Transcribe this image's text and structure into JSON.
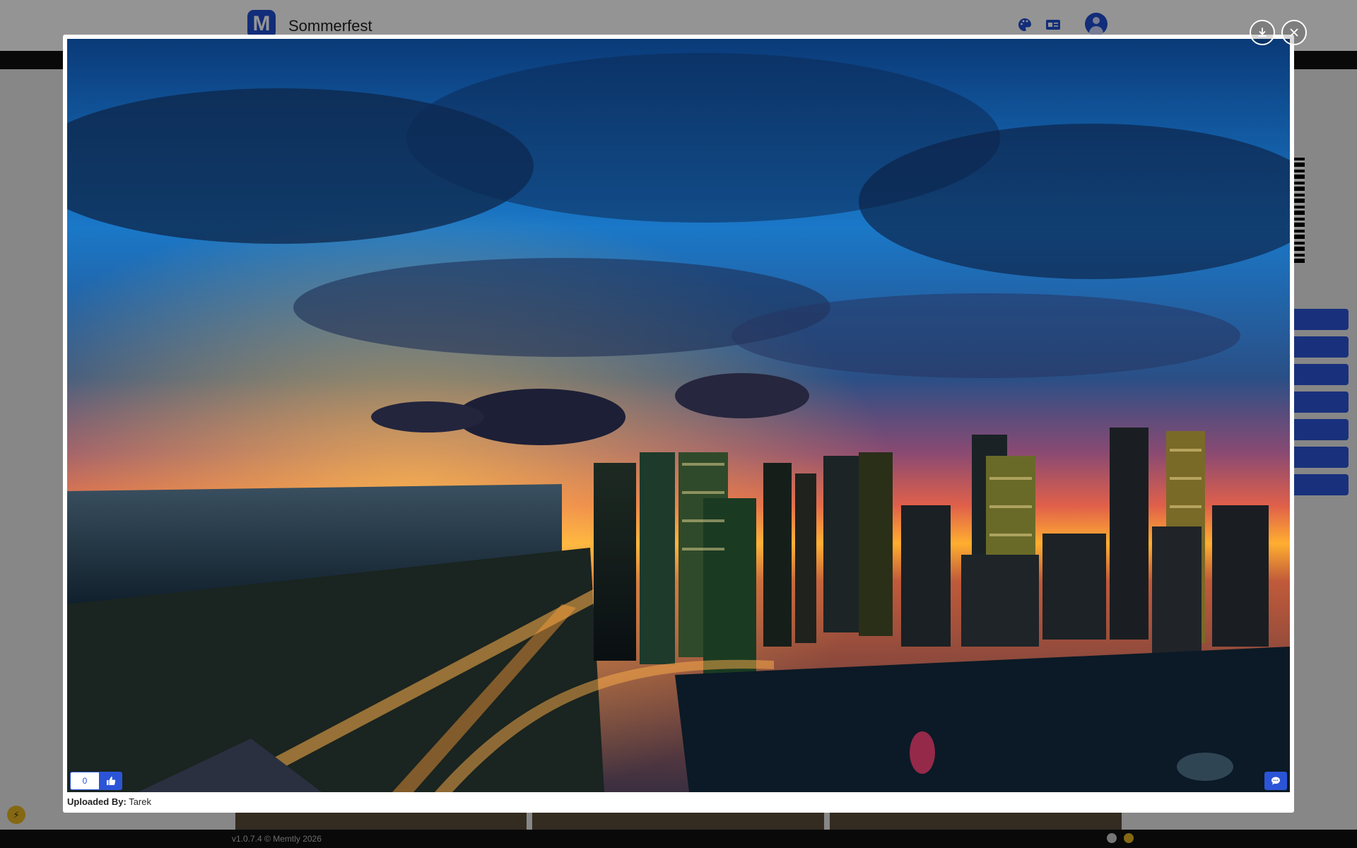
{
  "header": {
    "logo_letter": "M",
    "title": "Sommerfest",
    "icons": [
      "palette-icon",
      "id-card-icon",
      "user-avatar-icon"
    ]
  },
  "lightbox": {
    "like_count": "0",
    "uploaded_by_label": "Uploaded By:",
    "uploaded_by_name": "Tarek",
    "controls": [
      "download-icon",
      "close-icon"
    ],
    "like_icon": "thumbs-up-icon",
    "comment_icon": "comment-icon"
  },
  "footer": {
    "version_text": "v1.0.7.4 © Memtly 2026"
  },
  "colors": {
    "accent": "#2b55d6",
    "brand": "#1f4fd1",
    "footer_bg": "#111111"
  }
}
